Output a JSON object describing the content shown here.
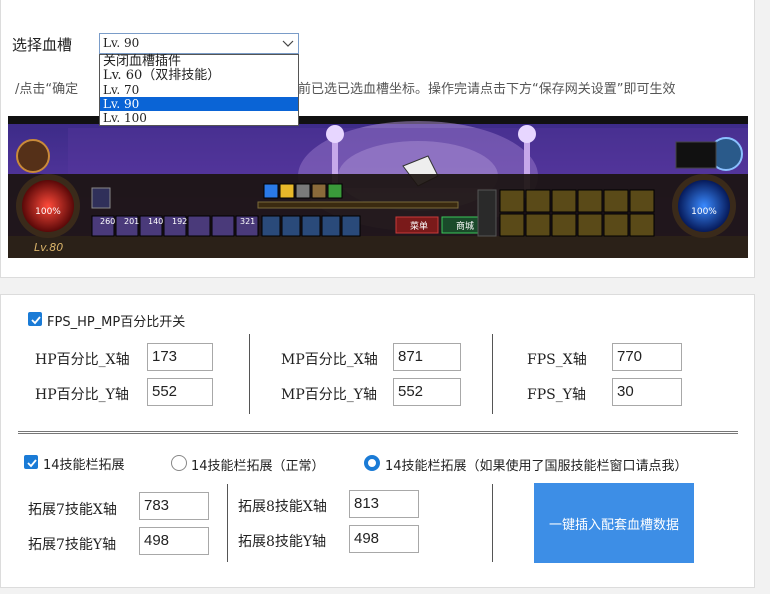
{
  "blood": {
    "label": "选择血槽",
    "selected": "Lv. 90",
    "options": [
      "关闭血槽插件",
      "Lv. 60（双排技能）",
      "Lv. 70",
      "Lv. 90",
      "Lv. 100"
    ],
    "selected_index": 3,
    "hint_left": "/点击“确定",
    "hint_right": "前已选已选血槽坐标。操作完请点击下方“保存网关设置”即可生效"
  },
  "game": {
    "level": "Lv.80",
    "hp": "100%",
    "mp": "100%",
    "skill_counts": [
      "260",
      "201",
      "140",
      "192",
      "321"
    ],
    "menu_label": "菜单",
    "shop_label": "商城"
  },
  "fps": {
    "toggle_label": "FPS_HP_MP百分比开关",
    "hp_x_label": "HP百分比_X轴",
    "hp_x_value": "173",
    "hp_y_label": "HP百分比_Y轴",
    "hp_y_value": "552",
    "mp_x_label": "MP百分比_X轴",
    "mp_x_value": "871",
    "mp_y_label": "MP百分比_Y轴",
    "mp_y_value": "552",
    "fps_x_label": "FPS_X轴",
    "fps_x_value": "770",
    "fps_y_label": "FPS_Y轴",
    "fps_y_value": "30"
  },
  "skills": {
    "toggle_label": "14技能栏拓展",
    "radio_normal": "14技能栏拓展（正常）",
    "radio_national": "14技能栏拓展（如果使用了国服技能栏窗口请点我）",
    "s7x_label": "拓展7技能X轴",
    "s7x_value": "783",
    "s7y_label": "拓展7技能Y轴",
    "s7y_value": "498",
    "s8x_label": "拓展8技能X轴",
    "s8x_value": "813",
    "s8y_label": "拓展8技能Y轴",
    "s8y_value": "498",
    "insert_button": "一键插入配套血槽数据"
  },
  "colors": {
    "accent": "#1a7bd6",
    "button": "#3d8ee6",
    "selection": "#0a64d6"
  }
}
